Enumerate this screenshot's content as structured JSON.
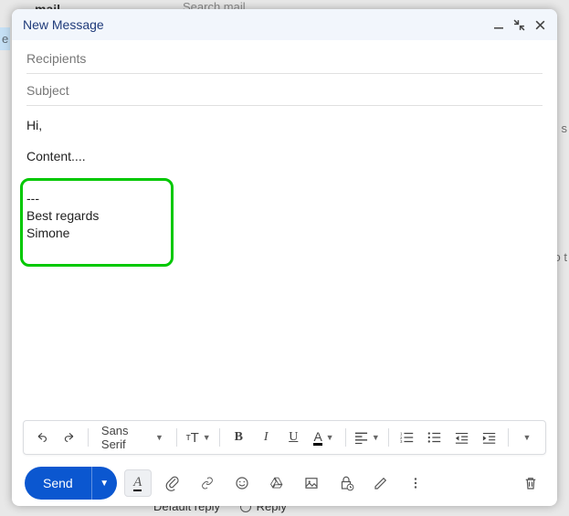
{
  "background": {
    "top_text": "mail",
    "search_placeholder": "Search mail",
    "right_text1": "s",
    "right_text2": "o t",
    "left_letter": "e",
    "bottom_default": "Default reply",
    "bottom_reply": "Reply"
  },
  "compose": {
    "title": "New Message",
    "recipients_placeholder": "Recipients",
    "subject_placeholder": "Subject",
    "body": {
      "greeting": "Hi,",
      "content": "Content....",
      "signature_sep": "---",
      "signature_line1": "Best regards",
      "signature_line2": "Simone"
    },
    "format_toolbar": {
      "font_label": "Sans Serif",
      "size_label": "тT",
      "bold": "B",
      "italic": "I",
      "underline": "U",
      "color_letter": "A"
    },
    "bottom": {
      "send_label": "Send",
      "formatting_a": "A"
    }
  }
}
